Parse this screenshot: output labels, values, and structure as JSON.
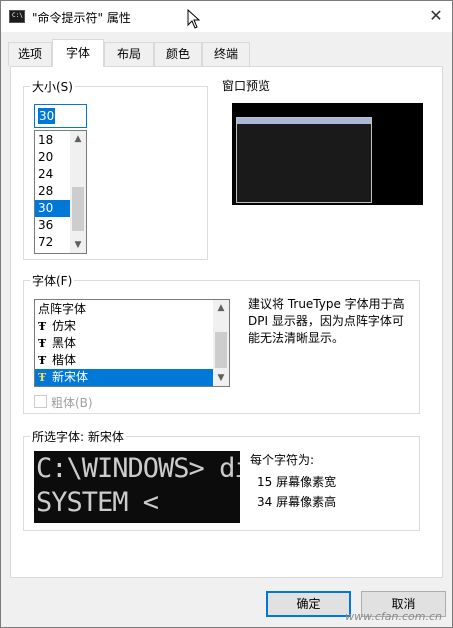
{
  "window": {
    "title": "\"命令提示符\" 属性",
    "title_icon_text": "C:\\",
    "close_glyph": "✕"
  },
  "tabs": [
    {
      "label": "选项"
    },
    {
      "label": "字体",
      "active": true
    },
    {
      "label": "布局"
    },
    {
      "label": "颜色"
    },
    {
      "label": "终端"
    }
  ],
  "size_group": {
    "label": "大小(S)",
    "value": "30",
    "options": [
      "18",
      "20",
      "24",
      "28",
      "30",
      "36",
      "72"
    ],
    "selected": "30"
  },
  "preview": {
    "label": "窗口预览"
  },
  "font_group": {
    "label": "字体(F)",
    "items": [
      {
        "label": "点阵字体",
        "icon": ""
      },
      {
        "label": "仿宋",
        "icon": "truetype-icon"
      },
      {
        "label": "黑体",
        "icon": "truetype-icon"
      },
      {
        "label": "楷体",
        "icon": "truetype-icon"
      },
      {
        "label": "新宋体",
        "icon": "truetype-icon",
        "selected": true
      }
    ],
    "icon_glyph": "Ŧ",
    "description": "建议将 TrueType 字体用于高 DPI 显示器，因为点阵字体可能无法清晰显示。",
    "bold_label": "粗体(B)"
  },
  "selected_font": {
    "label": "所选字体: 新宋体",
    "sample_lines": [
      "C:\\WINDOWS> di",
      "SYSTEM          <"
    ],
    "char_size_label": "每个字符为:",
    "width_text": "15 屏幕像素宽",
    "height_text": "34 屏幕像素高"
  },
  "buttons": {
    "ok": "确定",
    "cancel": "取消"
  },
  "watermark": "www.cfan.com.cn"
}
